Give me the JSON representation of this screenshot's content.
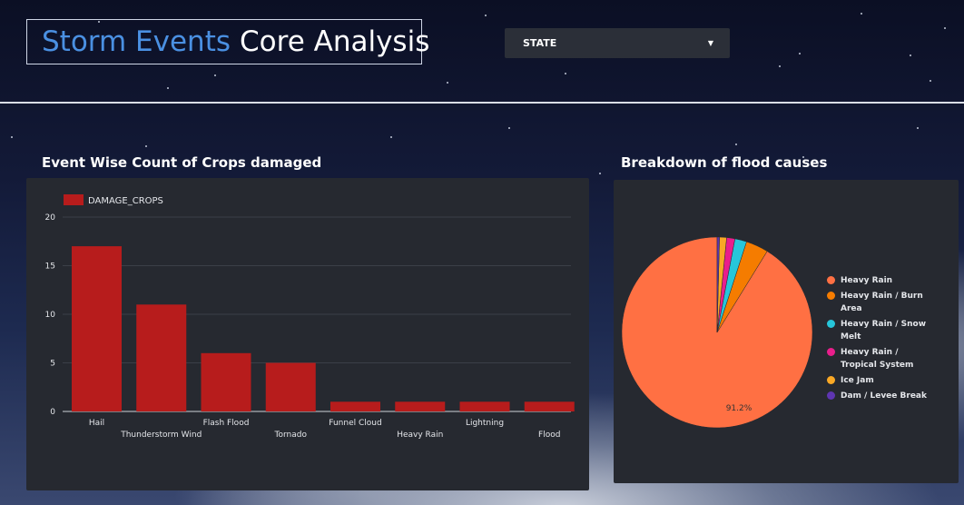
{
  "header": {
    "title_accent": "Storm Events",
    "title_rest": "Core Analysis",
    "state_dropdown_label": "STATE"
  },
  "bar_section": {
    "title": "Event Wise Count of Crops damaged"
  },
  "pie_section": {
    "title": "Breakdown of flood causes"
  },
  "colors": {
    "bar": "#b71c1c",
    "pie": [
      "#ff7043",
      "#f57c00",
      "#26c6da",
      "#e91e8c",
      "#f9a825",
      "#5e35b1"
    ]
  },
  "chart_data": [
    {
      "type": "bar",
      "title": "Event Wise Count of Crops damaged",
      "categories": [
        "Hail",
        "Thunderstorm Wind",
        "Flash Flood",
        "Tornado",
        "Funnel Cloud",
        "Heavy Rain",
        "Lightning",
        "Flood"
      ],
      "series": [
        {
          "name": "DAMAGE_CROPS",
          "values": [
            17,
            11,
            6,
            5,
            1,
            1,
            1,
            1
          ]
        }
      ],
      "ylim": [
        0,
        20
      ],
      "yticks": [
        0,
        5,
        10,
        15,
        20
      ],
      "grid": true,
      "legend": "top-left"
    },
    {
      "type": "pie",
      "title": "Breakdown of flood causes",
      "labels": [
        "Heavy Rain",
        "Heavy Rain / Burn Area",
        "Heavy Rain / Snow Melt",
        "Heavy Rain / Tropical System",
        "Ice Jam",
        "Dam / Levee Break"
      ],
      "values": [
        91.2,
        3.8,
        2.0,
        1.4,
        1.2,
        0.4
      ],
      "data_labels": [
        "91.2%"
      ],
      "legend": "right"
    }
  ]
}
